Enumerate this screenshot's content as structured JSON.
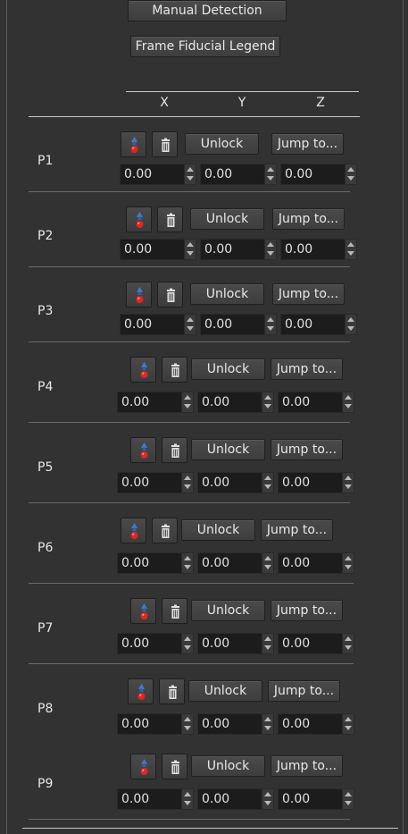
{
  "header": {
    "manual_detection_label": "Manual Detection",
    "legend_label": "Frame Fiducial Legend",
    "columns": [
      "X",
      "Y",
      "Z"
    ]
  },
  "fiducials": [
    {
      "label": "P1",
      "unlock": "Unlock",
      "jump": "Jump to...",
      "x": "0.00",
      "y": "0.00",
      "z": "0.00"
    },
    {
      "label": "P2",
      "unlock": "Unlock",
      "jump": "Jump to...",
      "x": "0.00",
      "y": "0.00",
      "z": "0.00"
    },
    {
      "label": "P3",
      "unlock": "Unlock",
      "jump": "Jump to...",
      "x": "0.00",
      "y": "0.00",
      "z": "0.00"
    },
    {
      "label": "P4",
      "unlock": "Unlock",
      "jump": "Jump to...",
      "x": "0.00",
      "y": "0.00",
      "z": "0.00"
    },
    {
      "label": "P5",
      "unlock": "Unlock",
      "jump": "Jump to...",
      "x": "0.00",
      "y": "0.00",
      "z": "0.00"
    },
    {
      "label": "P6",
      "unlock": "Unlock",
      "jump": "Jump to...",
      "x": "0.00",
      "y": "0.00",
      "z": "0.00"
    },
    {
      "label": "P7",
      "unlock": "Unlock",
      "jump": "Jump to...",
      "x": "0.00",
      "y": "0.00",
      "z": "0.00"
    },
    {
      "label": "P8",
      "unlock": "Unlock",
      "jump": "Jump to...",
      "x": "0.00",
      "y": "0.00",
      "z": "0.00"
    },
    {
      "label": "P9",
      "unlock": "Unlock",
      "jump": "Jump to...",
      "x": "0.00",
      "y": "0.00",
      "z": "0.00"
    }
  ],
  "icons": {
    "place": "place-fiducial-icon",
    "delete": "trash-icon"
  }
}
